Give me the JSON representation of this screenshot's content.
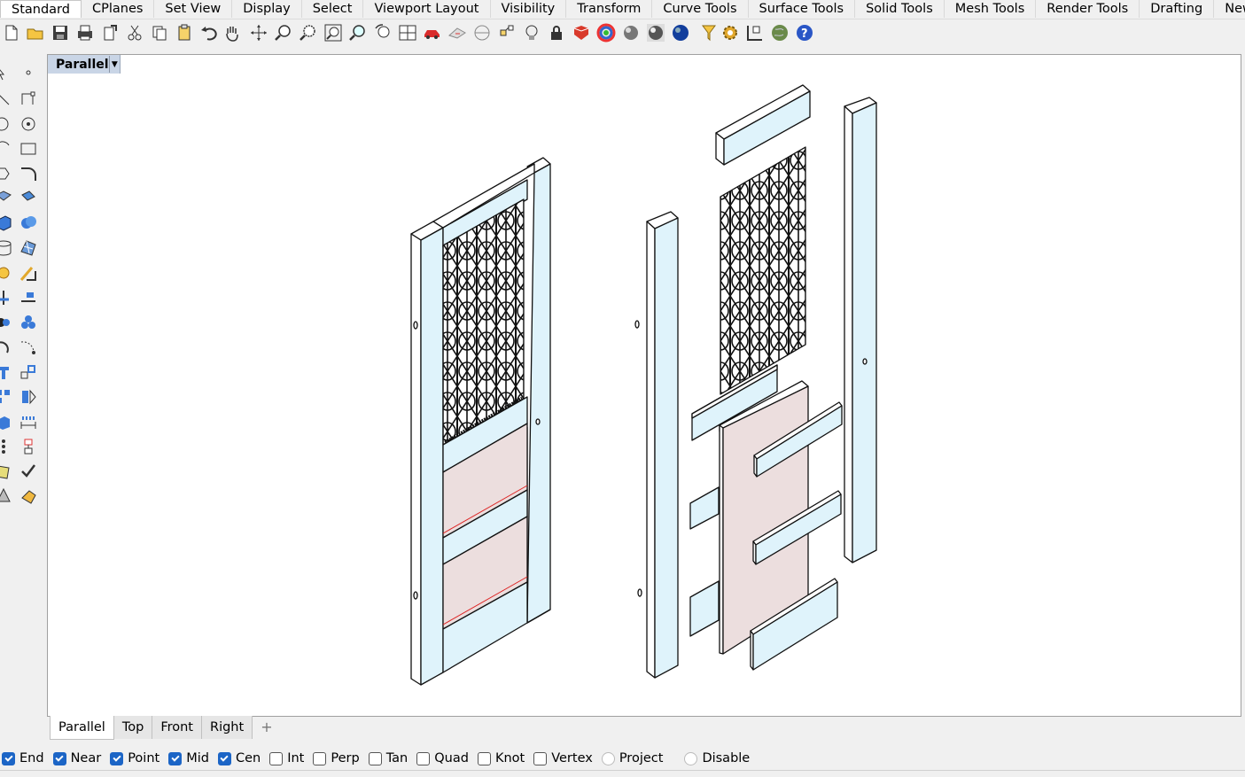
{
  "ribbon_tabs": [
    "Standard",
    "CPlanes",
    "Set View",
    "Display",
    "Select",
    "Viewport Layout",
    "Visibility",
    "Transform",
    "Curve Tools",
    "Surface Tools",
    "Solid Tools",
    "Mesh Tools",
    "Render Tools",
    "Drafting",
    "New"
  ],
  "viewport": {
    "title": "Parallel"
  },
  "viewport_tabs": [
    "Parallel",
    "Top",
    "Front",
    "Right"
  ],
  "osnaps": [
    {
      "label": "End",
      "checked": true
    },
    {
      "label": "Near",
      "checked": true
    },
    {
      "label": "Point",
      "checked": true
    },
    {
      "label": "Mid",
      "checked": true
    },
    {
      "label": "Cen",
      "checked": true
    },
    {
      "label": "Int",
      "checked": false
    },
    {
      "label": "Perp",
      "checked": false
    },
    {
      "label": "Tan",
      "checked": false
    },
    {
      "label": "Quad",
      "checked": false
    },
    {
      "label": "Knot",
      "checked": false
    },
    {
      "label": "Vertex",
      "checked": false
    },
    {
      "label": "Project",
      "checked": false
    },
    {
      "label": "Disable",
      "checked": false
    }
  ],
  "colors": {
    "frame_fill": "#dff3fb",
    "panel_fill": "#ecdede",
    "accent": "#1c65c6"
  }
}
